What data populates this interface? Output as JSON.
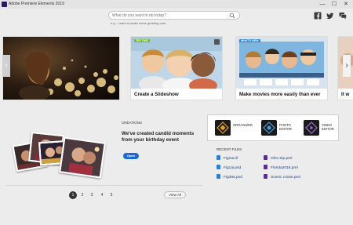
{
  "window": {
    "title": "Adobe Premiere Elements 2019",
    "minimize": "—",
    "maximize": "☐",
    "close": "✕"
  },
  "search": {
    "placeholder": "What do you want to do today?",
    "hint": "e.g.: I want to make some greeting card"
  },
  "social": [
    "facebook-icon",
    "twitter-icon",
    "chat-icon"
  ],
  "features": [
    {
      "caption": "",
      "badge": ""
    },
    {
      "caption": "Create a Slideshow",
      "badge": "TRY THIS"
    },
    {
      "caption": "Make movies more easily than ever",
      "badge": "WHAT'S NEW"
    },
    {
      "caption": "It w",
      "badge": ""
    }
  ],
  "creations": {
    "label": "CREATIONS",
    "title": "We've created candid moments from your birthday event",
    "open_label": "Open"
  },
  "pagination": {
    "pages": [
      "1",
      "2",
      "3",
      "4",
      "5"
    ],
    "active": "1",
    "view_all": "View All"
  },
  "launcher": {
    "apps": [
      {
        "label": "ORGANIZER",
        "icon": "organizer-icon",
        "color": "#e0a030"
      },
      {
        "label": "PHOTO EDITOR",
        "icon": "photo-editor-icon",
        "color": "#4aa0e8"
      },
      {
        "label": "VIDEO EDITOR",
        "icon": "video-editor-icon",
        "color": "#a070e0"
      }
    ]
  },
  "recent": {
    "title": "RECENT FILES",
    "files": [
      {
        "name": "Fig1ai.tif",
        "type": "image"
      },
      {
        "name": "Ohio trip.prel",
        "type": "video"
      },
      {
        "name": "Fig1ai.psd",
        "type": "image"
      },
      {
        "name": "Florida2018.prel",
        "type": "video"
      },
      {
        "name": "Fig39a.psd",
        "type": "image"
      },
      {
        "name": "Scenic cruise.prel",
        "type": "video"
      }
    ]
  },
  "colors": {
    "accent": "#1a6bd6",
    "background": "#ececec",
    "file_image": "#2d7fd0",
    "file_video": "#5b2d8e"
  }
}
